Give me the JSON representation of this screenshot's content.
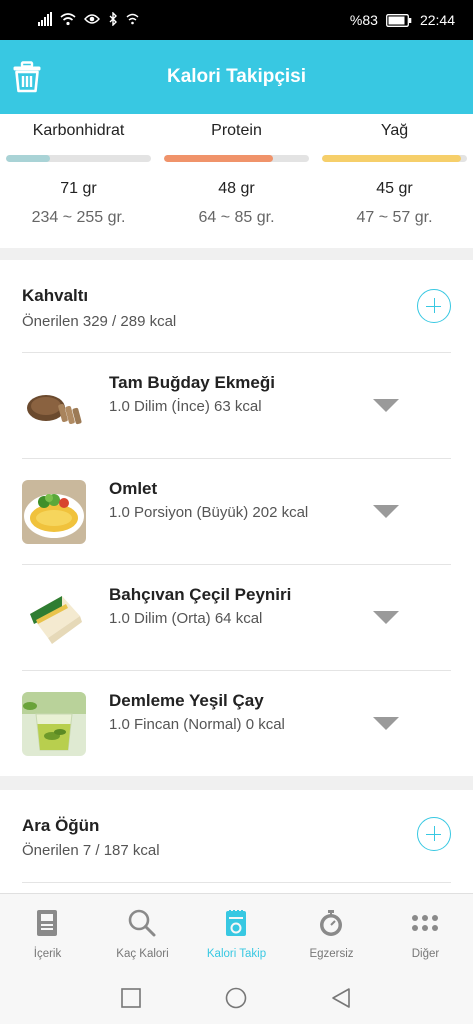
{
  "status_bar": {
    "battery": "%83",
    "time": "22:44"
  },
  "header": {
    "title": "Kalori Takipçisi"
  },
  "macros": [
    {
      "label": "Karbonhidrat",
      "value": "71 gr",
      "range": "234 ~ 255 gr.",
      "progress": 0.3,
      "color": "#a9d3d6"
    },
    {
      "label": "Protein",
      "value": "48 gr",
      "range": "64 ~ 85 gr.",
      "progress": 0.75,
      "color": "#f0936a"
    },
    {
      "label": "Yağ",
      "value": "45 gr",
      "range": "47 ~ 57 gr.",
      "progress": 0.96,
      "color": "#f6cf6a"
    }
  ],
  "breakfast": {
    "title": "Kahvaltı",
    "subtitle": "Önerilen 329 / 289 kcal",
    "items": [
      {
        "name": "Tam Buğday Ekmeği",
        "detail": "1.0 Dilim (İnce) 63 kcal"
      },
      {
        "name": "Omlet",
        "detail": "1.0 Porsiyon (Büyük) 202 kcal"
      },
      {
        "name": "Bahçıvan Çeçil Peyniri",
        "detail": "1.0 Dilim (Orta) 64 kcal"
      },
      {
        "name": "Demleme Yeşil Çay",
        "detail": "1.0 Fincan (Normal) 0 kcal"
      }
    ]
  },
  "snack": {
    "title": "Ara Öğün",
    "subtitle": "Önerilen 7 / 187 kcal"
  },
  "nav": {
    "items": [
      {
        "label": "İçerik",
        "icon": "document-icon"
      },
      {
        "label": "Kaç Kalori",
        "icon": "search-icon"
      },
      {
        "label": "Kalori Takip",
        "icon": "calorie-tracker-icon"
      },
      {
        "label": "Egzersiz",
        "icon": "stopwatch-icon"
      },
      {
        "label": "Diğer",
        "icon": "more-dots-icon"
      }
    ],
    "active_color": "#38c8e2",
    "inactive_color": "#8a8a8a"
  },
  "colors": {
    "accent": "#38c8e2"
  }
}
